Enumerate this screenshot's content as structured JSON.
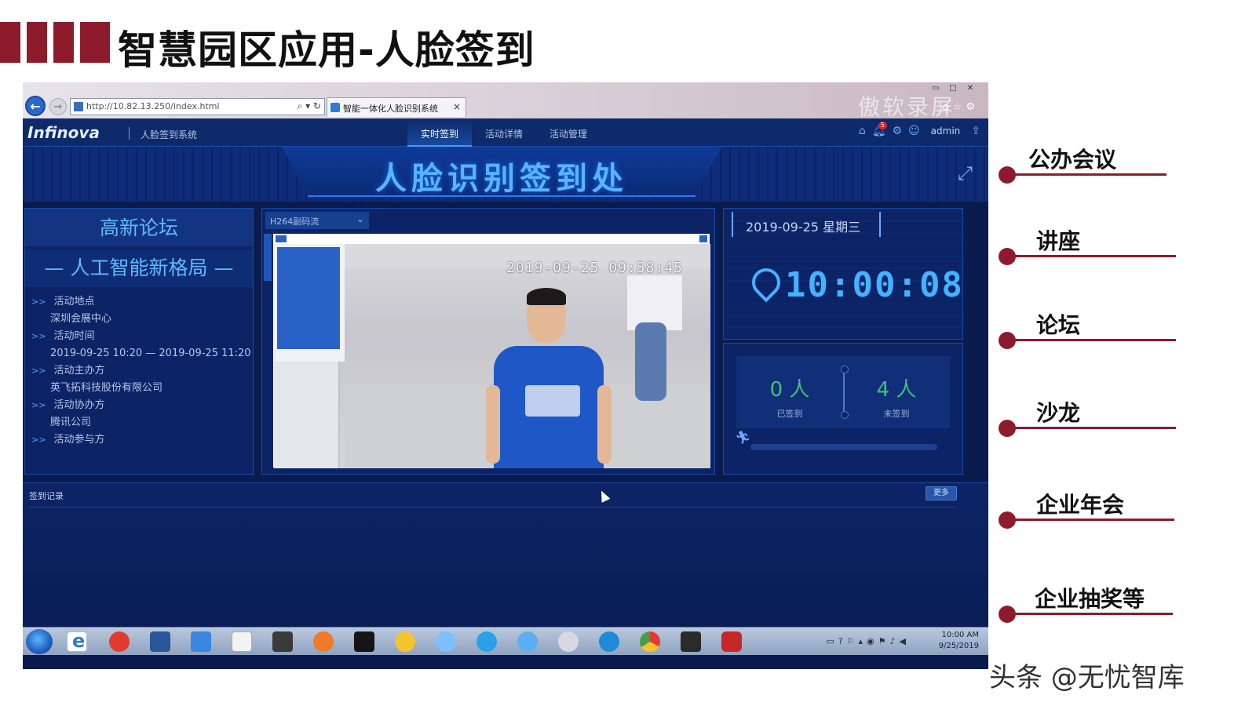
{
  "slide": {
    "title": "智慧园区应用-人脸签到",
    "accent_color": "#8e1b2c",
    "footer_watermark": "头条 @无忧智库",
    "right_list": [
      "公办会议",
      "讲座",
      "论坛",
      "沙龙",
      "企业年会",
      "企业抽奖等"
    ]
  },
  "browser": {
    "url": "http://10.82.13.250/index.html",
    "tab_title": "智能一体化人脸识别系统",
    "watermark": "傲软录屏"
  },
  "app": {
    "logo": "Infinova",
    "system_name": "人脸签到系统",
    "nav": [
      "实时签到",
      "活动详情",
      "活动管理"
    ],
    "active_nav": "实时签到",
    "notification_count": "5",
    "user": "admin",
    "banner_title": "人脸识别签到处"
  },
  "info": {
    "title": "高新论坛",
    "subtitle": "— 人工智能新格局 —",
    "fields": [
      {
        "key": "活动地点",
        "value": "深圳会展中心"
      },
      {
        "key": "活动时间",
        "value": "2019-09-25 10:20 — 2019-09-25 11:20"
      },
      {
        "key": "活动主办方",
        "value": "英飞拓科技股份有限公司"
      },
      {
        "key": "活动协办方",
        "value": "腾讯公司"
      },
      {
        "key": "活动参与方",
        "value": ""
      }
    ]
  },
  "video": {
    "stream_option": "H264副码流",
    "osd_timestamp": "2019-09-25  09:58:45"
  },
  "clock": {
    "date": "2019-09-25 星期三",
    "time": "10:00:08"
  },
  "stats": {
    "signed_count": "0 人",
    "signed_label": "已签到",
    "unsigned_count": "4 人",
    "unsigned_label": "未签到",
    "progress_fraction": 0
  },
  "records": {
    "title": "签到记录",
    "more_label": "更多"
  },
  "taskbar": {
    "time": "10:00 AM",
    "date": "9/25/2019"
  }
}
